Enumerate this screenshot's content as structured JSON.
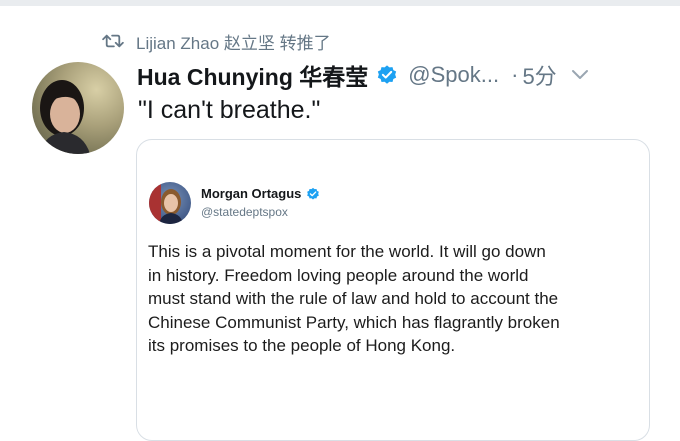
{
  "retweet": {
    "text": "Lijian Zhao 赵立坚 转推了",
    "icon": "retweet-icon"
  },
  "tweet": {
    "author_name": "Hua Chunying 华春莹",
    "handle": "@Spok...",
    "separator": "·",
    "time": "5分",
    "text": "\"I can't breathe.\"",
    "verified_icon": "verified-badge-icon",
    "menu_icon": "chevron-down-icon"
  },
  "quoted": {
    "author_name": "Morgan Ortagus",
    "handle": "@statedeptspox",
    "verified_icon": "verified-badge-icon",
    "body_lines": [
      "This is a pivotal moment for the world. It will go down",
      "in history. Freedom loving people around the world",
      "must stand with the rule of law and hold to account the",
      "Chinese Communist Party, which has flagrantly broken",
      "its promises to the people of Hong Kong."
    ]
  },
  "colors": {
    "text_primary": "#14171a",
    "text_secondary": "#657786",
    "verified_blue": "#1da1f2",
    "card_border": "#d9dfe5"
  }
}
